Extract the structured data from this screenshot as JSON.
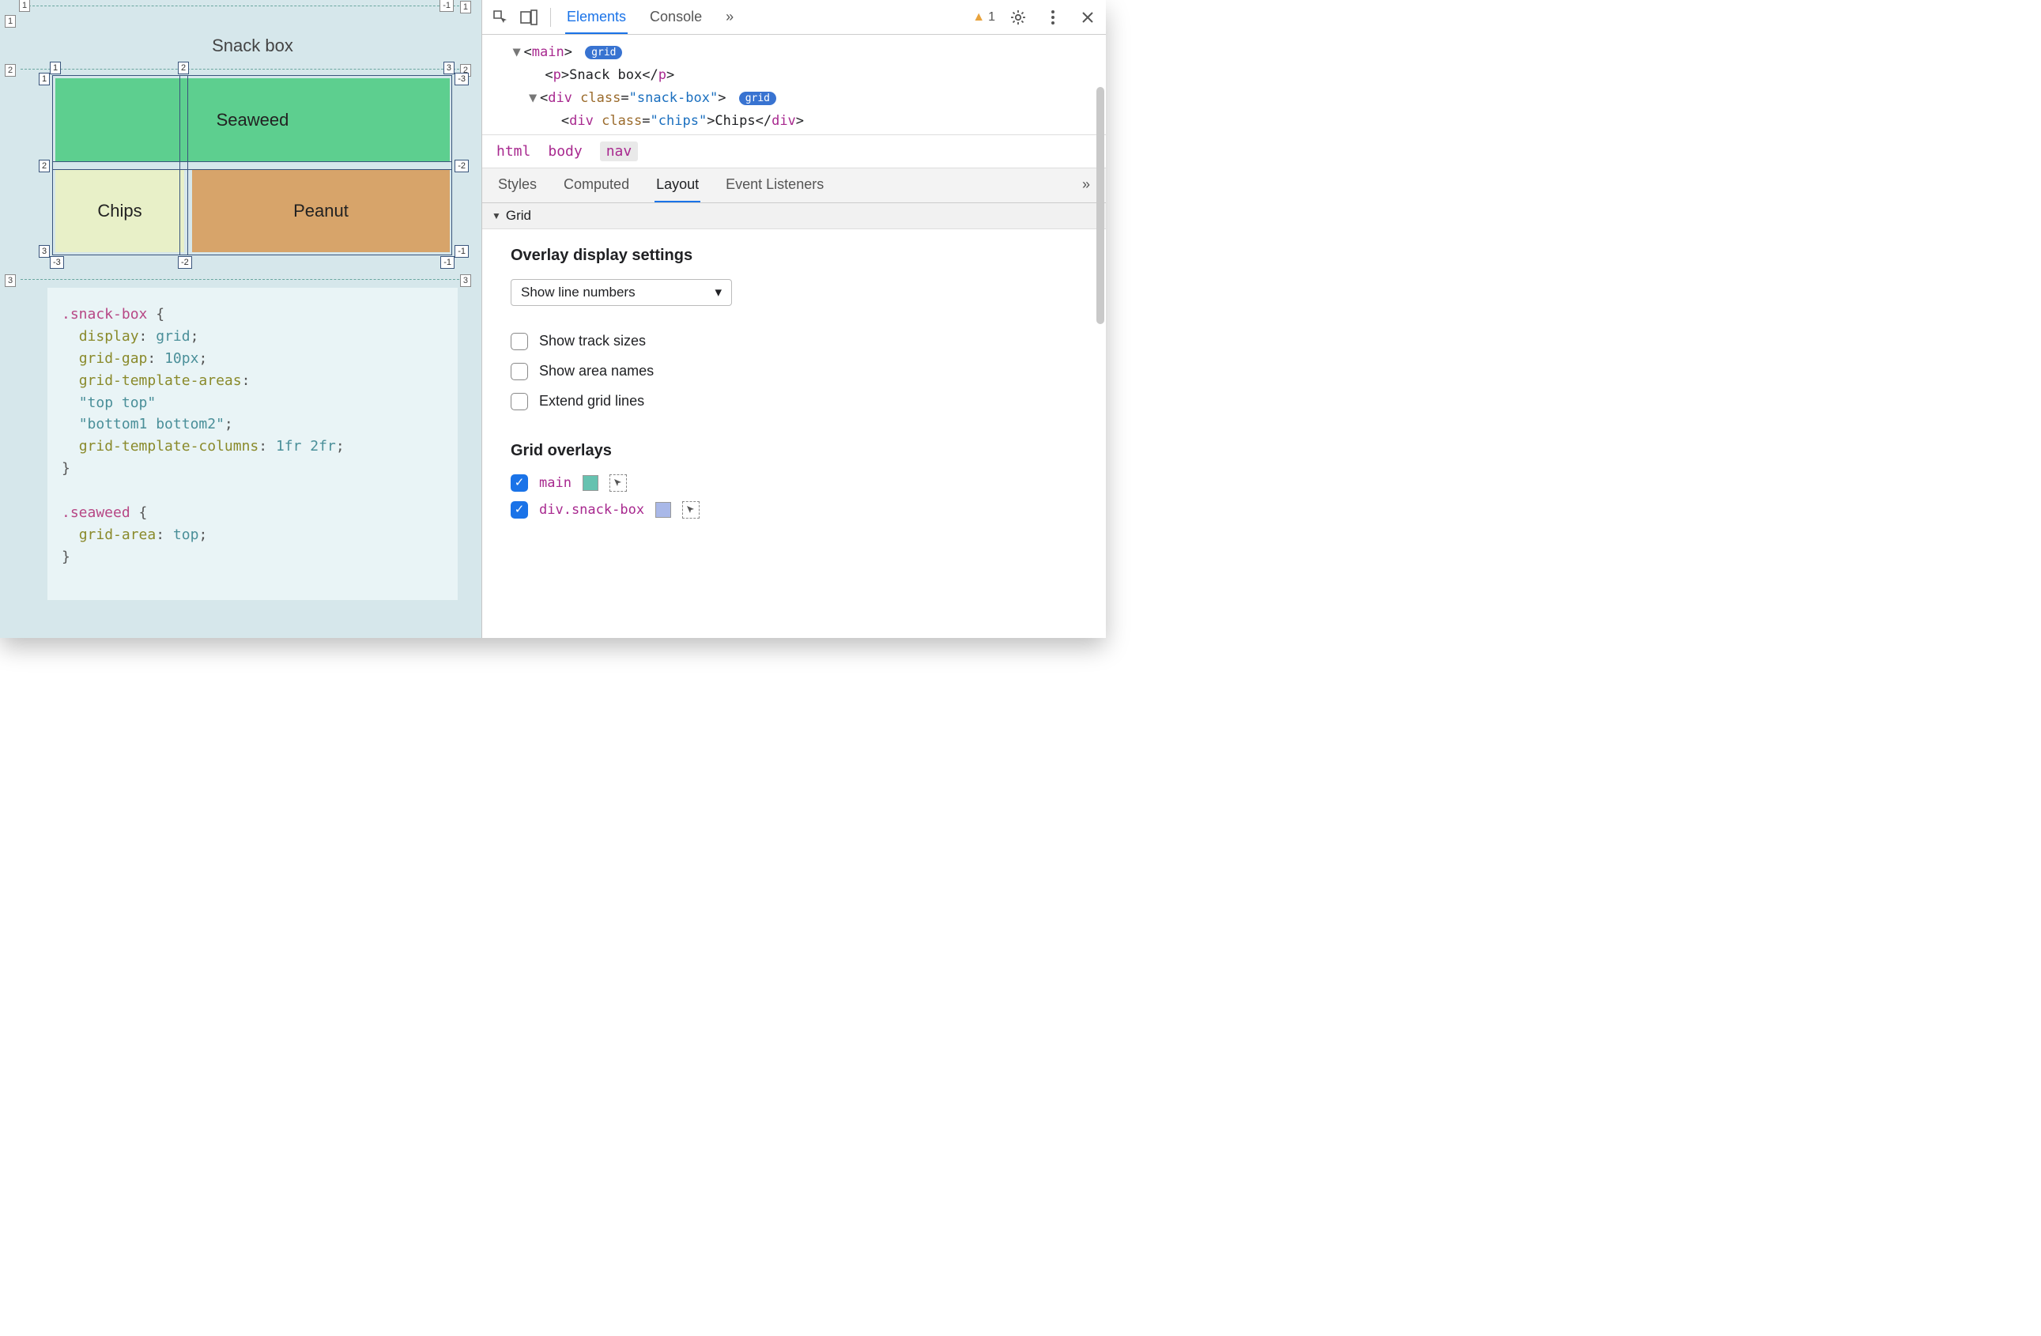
{
  "preview": {
    "title": "Snack box",
    "cells": {
      "seaweed": "Seaweed",
      "chips": "Chips",
      "peanut": "Peanut"
    },
    "outer_labels": {
      "top": [
        "1",
        "-1"
      ],
      "right": [
        "1",
        "2",
        "3"
      ],
      "left": [
        "1",
        "2",
        "3"
      ]
    },
    "inner_labels": {
      "cols_top": [
        "1",
        "2",
        "3"
      ],
      "cols_bottom": [
        "-3",
        "-2",
        "-1"
      ],
      "rows_left": [
        "1",
        "2",
        "3"
      ],
      "rows_right": [
        "-3",
        "-2",
        "-1"
      ]
    },
    "code": {
      "block1_selector": ".snack-box",
      "block1_lines": [
        {
          "prop": "display",
          "val": "grid"
        },
        {
          "prop": "grid-gap",
          "val": "10px"
        },
        {
          "prop": "grid-template-areas",
          "val": ""
        },
        {
          "raw": "\"top top\""
        },
        {
          "raw": "\"bottom1 bottom2\"",
          "semicolon": true
        },
        {
          "prop": "grid-template-columns",
          "val": "1fr 2fr"
        }
      ],
      "block2_selector": ".seaweed",
      "block2_lines": [
        {
          "prop": "grid-area",
          "val": "top"
        }
      ]
    }
  },
  "devtools": {
    "main_tabs": [
      "Elements",
      "Console"
    ],
    "main_tab_active": "Elements",
    "more_tabs_glyph": "»",
    "warning_count": "1",
    "dom": {
      "line1_tag": "main",
      "line2_tag": "p",
      "line2_text": "Snack box",
      "line3_tag": "div",
      "line3_class": "snack-box",
      "line4_tag": "div",
      "line4_class": "chips",
      "line4_text": "Chips",
      "badge": "grid"
    },
    "crumbs": [
      "html",
      "body",
      "nav"
    ],
    "crumb_active": "nav",
    "subtabs": [
      "Styles",
      "Computed",
      "Layout",
      "Event Listeners"
    ],
    "subtab_active": "Layout",
    "layout": {
      "section": "Grid",
      "settings_title": "Overlay display settings",
      "select_value": "Show line numbers",
      "checkboxes": [
        {
          "label": "Show track sizes",
          "checked": false
        },
        {
          "label": "Show area names",
          "checked": false
        },
        {
          "label": "Extend grid lines",
          "checked": false
        }
      ],
      "overlays_title": "Grid overlays",
      "overlays": [
        {
          "label": "main",
          "checked": true,
          "swatch": "#66c2b0"
        },
        {
          "label": "div.snack-box",
          "checked": true,
          "swatch": "#a9b8e8"
        }
      ]
    }
  }
}
